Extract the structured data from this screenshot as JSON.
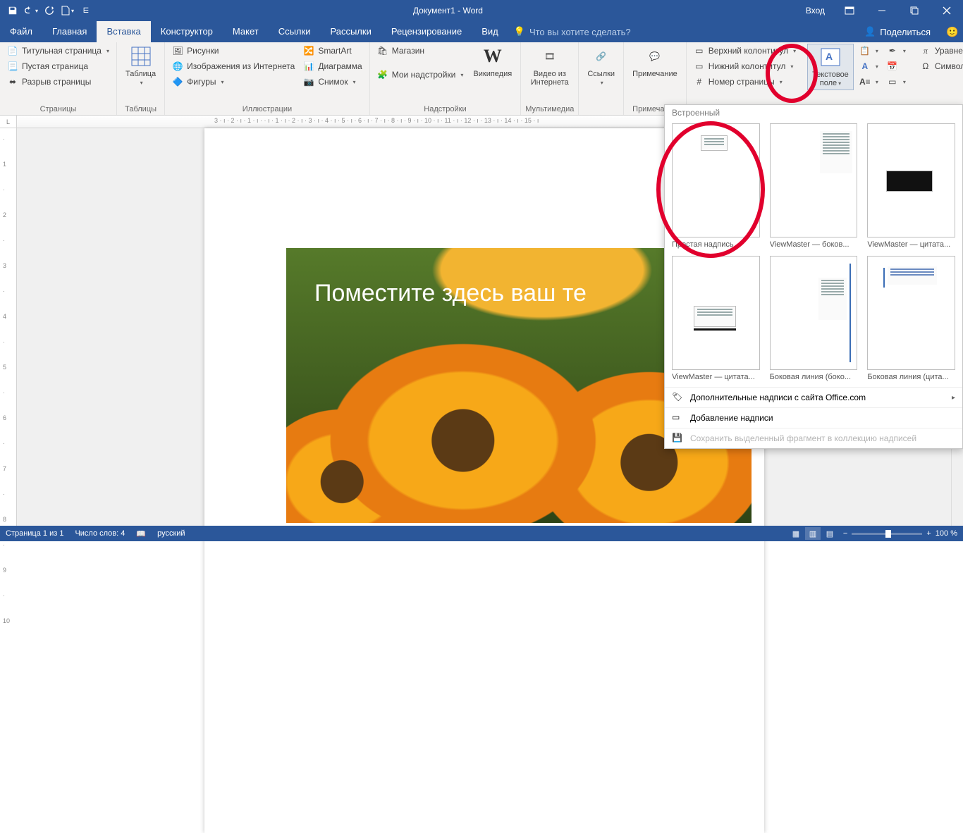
{
  "titlebar": {
    "title": "Документ1 - Word",
    "signin": "Вход"
  },
  "tabs": {
    "file": "Файл",
    "list": [
      "Главная",
      "Вставка",
      "Конструктор",
      "Макет",
      "Ссылки",
      "Рассылки",
      "Рецензирование",
      "Вид"
    ],
    "active": 1,
    "search_placeholder": "Что вы хотите сделать?",
    "share": "Поделиться"
  },
  "ribbon": {
    "pages": {
      "cover": "Титульная страница",
      "blank": "Пустая страница",
      "break": "Разрыв страницы",
      "label": "Страницы"
    },
    "tables": {
      "btn": "Таблица",
      "label": "Таблицы"
    },
    "illus": {
      "pictures": "Рисунки",
      "online": "Изображения из Интернета",
      "shapes": "Фигуры",
      "smartart": "SmartArt",
      "chart": "Диаграмма",
      "screenshot": "Снимок",
      "label": "Иллюстрации"
    },
    "addins": {
      "store": "Магазин",
      "myaddins": "Мои надстройки",
      "wiki": "Википедия",
      "label": "Надстройки"
    },
    "media": {
      "video": "Видео из Интернета",
      "label": "Мультимедиа"
    },
    "links": {
      "btn": "Ссылки",
      "label": ""
    },
    "comments": {
      "btn": "Примечание",
      "label": "Примечания"
    },
    "headerfooter": {
      "header": "Верхний колонтитул",
      "footer": "Нижний колонтитул",
      "pagenum": "Номер страницы"
    },
    "text": {
      "textbox": "Текстовое поле"
    },
    "symbols": {
      "equation": "Уравнение",
      "symbol": "Символ"
    }
  },
  "gallery": {
    "heading": "Встроенный",
    "items": [
      {
        "cap": "Простая надпись"
      },
      {
        "cap": "ViewMaster — боков..."
      },
      {
        "cap": "ViewMaster — цитата..."
      },
      {
        "cap": "ViewMaster — цитата..."
      },
      {
        "cap": "Боковая линия (боко..."
      },
      {
        "cap": "Боковая линия (цита..."
      }
    ],
    "more": "Дополнительные надписи с сайта Office.com",
    "draw": "Добавление надписи",
    "save": "Сохранить выделенный фрагмент в коллекцию надписей"
  },
  "page_text": "Поместите здесь ваш те",
  "ruler_h": "3 · ı · 2 · ı · 1 · ı ·     · ı · 1 · ı · 2 · ı · 3 · ı · 4 · ı · 5 · ı · 6 · ı · 7 · ı · 8 · ı · 9 · ı · 10 · ı · 11 · ı · 12 · ı · 13 · ı · 14 · ı · 15 · ı",
  "status": {
    "page": "Страница 1 из 1",
    "words": "Число слов: 4",
    "lang": "русский",
    "zoom": "100 %"
  }
}
